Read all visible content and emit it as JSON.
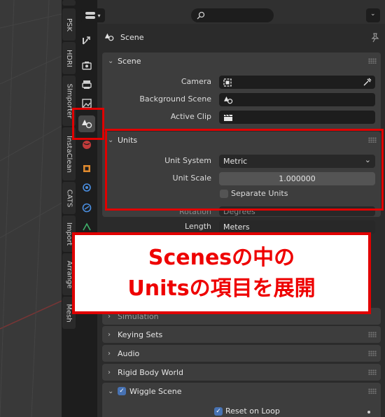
{
  "tabs": [
    {
      "label": "PSK"
    },
    {
      "label": "HDRI"
    },
    {
      "label": "SImporter"
    },
    {
      "label": "InstaClean"
    },
    {
      "label": "CATS"
    },
    {
      "label": "Import"
    },
    {
      "label": "Arrange"
    },
    {
      "label": "Mesh"
    }
  ],
  "header": {
    "title": "Scene"
  },
  "scene_panel": {
    "title": "Scene",
    "camera_label": "Camera",
    "background_scene_label": "Background Scene",
    "active_clip_label": "Active Clip"
  },
  "units_panel": {
    "title": "Units",
    "unit_system_label": "Unit System",
    "unit_system_value": "Metric",
    "unit_scale_label": "Unit Scale",
    "unit_scale_value": "1.000000",
    "separate_units_label": "Separate Units",
    "rotation_label": "Rotation",
    "rotation_value": "Degrees",
    "length_label": "Length",
    "length_value": "Meters"
  },
  "collapsed_panels": [
    {
      "title": "Simulation"
    },
    {
      "title": "Keying Sets"
    },
    {
      "title": "Audio"
    },
    {
      "title": "Rigid Body World"
    }
  ],
  "wiggle_panel": {
    "title": "Wiggle Scene",
    "reset_on_loop_label": "Reset on Loop"
  },
  "annotation": {
    "line1": "Scenesの中の",
    "line2": "Unitsの項目を展開"
  },
  "colors": {
    "highlight": "#e00000",
    "accent": "#4772b3"
  }
}
